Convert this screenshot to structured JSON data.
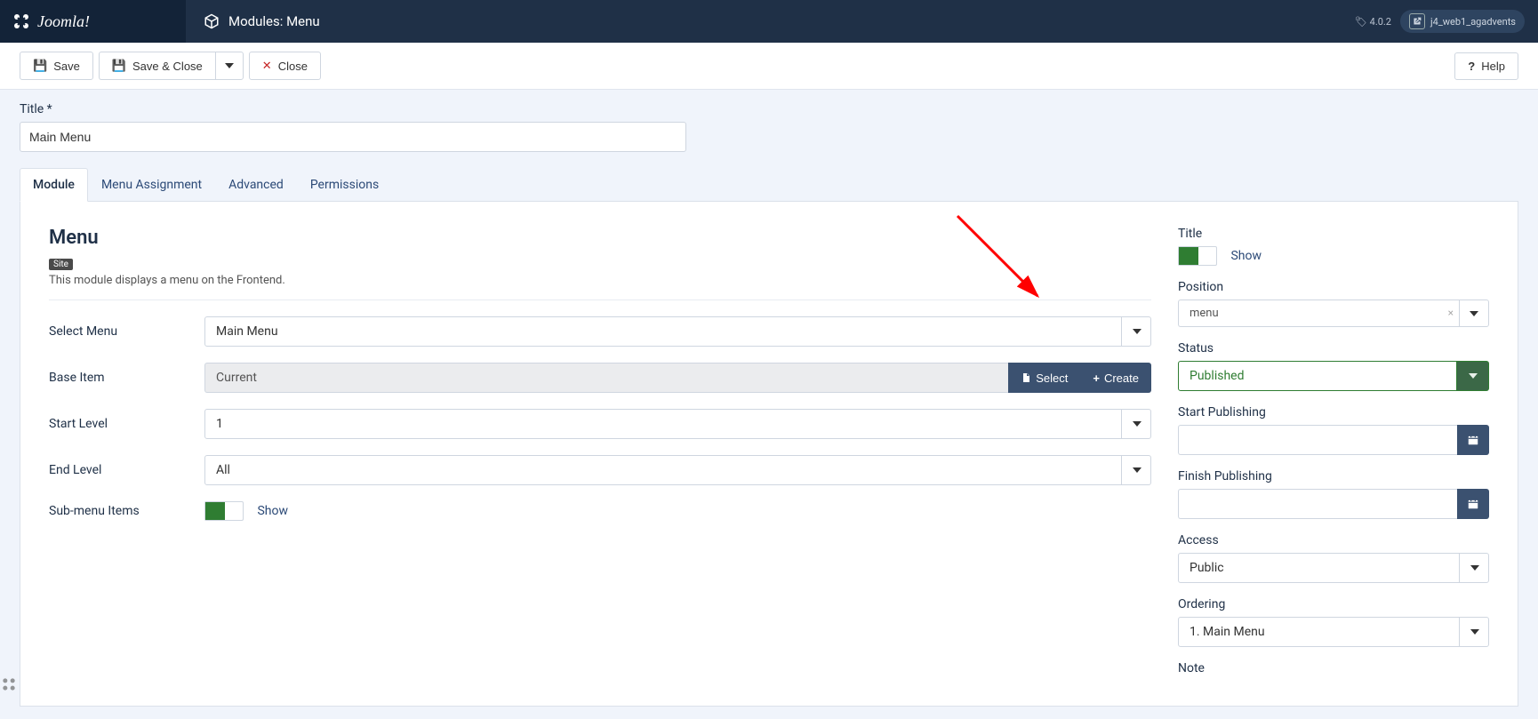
{
  "brand": "Joomla!",
  "page_title": "Modules: Menu",
  "version": "4.0.2",
  "user": "j4_web1_agadvents",
  "toolbar": {
    "save": "Save",
    "save_close": "Save & Close",
    "close": "Close",
    "help": "Help"
  },
  "form": {
    "title_label": "Title",
    "title_value": "Main Menu"
  },
  "tabs": [
    "Module",
    "Menu Assignment",
    "Advanced",
    "Permissions"
  ],
  "module": {
    "heading": "Menu",
    "badge": "Site",
    "desc": "This module displays a menu on the Frontend.",
    "fields": {
      "select_menu": {
        "label": "Select Menu",
        "value": "Main Menu"
      },
      "base_item": {
        "label": "Base Item",
        "value": "Current",
        "select": "Select",
        "create": "Create"
      },
      "start_level": {
        "label": "Start Level",
        "value": "1"
      },
      "end_level": {
        "label": "End Level",
        "value": "All"
      },
      "sub_menu": {
        "label": "Sub-menu Items",
        "value": "Show"
      }
    }
  },
  "side": {
    "title": {
      "label": "Title",
      "value": "Show"
    },
    "position": {
      "label": "Position",
      "value": "menu"
    },
    "status": {
      "label": "Status",
      "value": "Published"
    },
    "start_pub": {
      "label": "Start Publishing",
      "value": ""
    },
    "finish_pub": {
      "label": "Finish Publishing",
      "value": ""
    },
    "access": {
      "label": "Access",
      "value": "Public"
    },
    "ordering": {
      "label": "Ordering",
      "value": "1. Main Menu"
    },
    "note": {
      "label": "Note"
    }
  }
}
